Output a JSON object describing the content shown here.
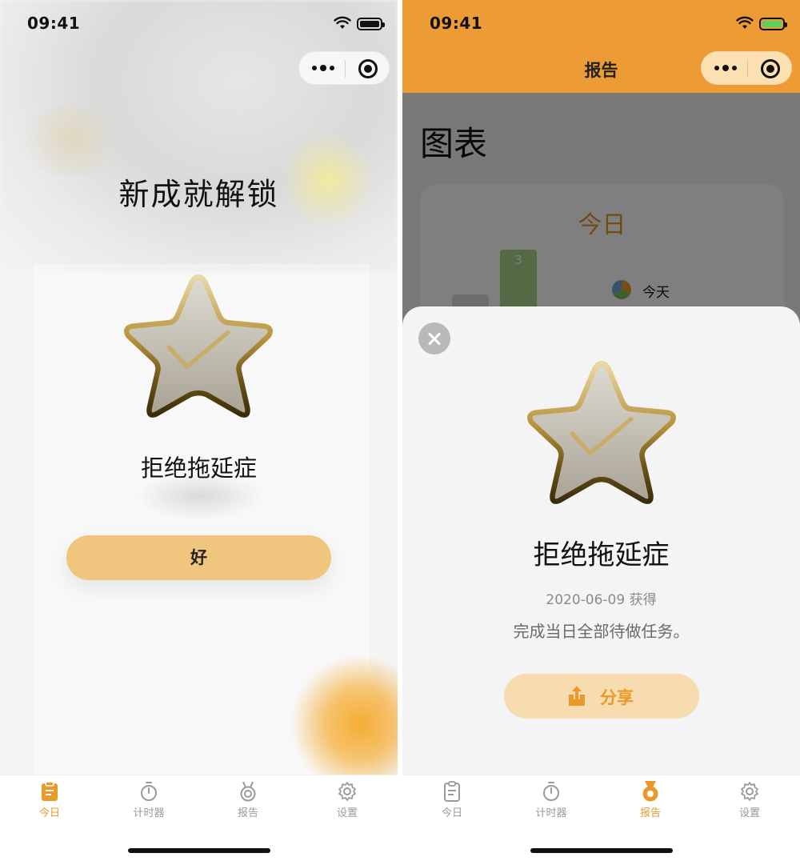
{
  "status_bar": {
    "time": "09:41"
  },
  "achievement_popup": {
    "title": "新成就解锁",
    "badge_name": "拒绝拖延症",
    "ok_button": "好"
  },
  "report_page": {
    "nav_title": "报告",
    "page_title": "图表",
    "chart_card_title": "今日",
    "chart_data": {
      "type": "bar",
      "categories": [
        "",
        ""
      ],
      "values": [
        2,
        3
      ],
      "legend": [
        "今天"
      ]
    },
    "bar_data_label": "3",
    "legend_label": "今天"
  },
  "badge_sheet": {
    "badge_name": "拒绝拖延症",
    "date_text": "2020-06-09 获得",
    "description": "完成当日全部待做任务。",
    "share_button": "分享"
  },
  "tabs": [
    {
      "label": "今日",
      "icon": "clipboard-icon"
    },
    {
      "label": "计时器",
      "icon": "timer-icon"
    },
    {
      "label": "报告",
      "icon": "medal-icon"
    },
    {
      "label": "设置",
      "icon": "gear-icon"
    }
  ],
  "left_active_tab": 0,
  "right_active_tab": 2,
  "colors": {
    "accent": "#ed9c35",
    "button": "#f0c57e",
    "share_button": "#f6dcae",
    "active_tab": "#e99a2a",
    "inactive_tab": "#9a9a9a"
  }
}
